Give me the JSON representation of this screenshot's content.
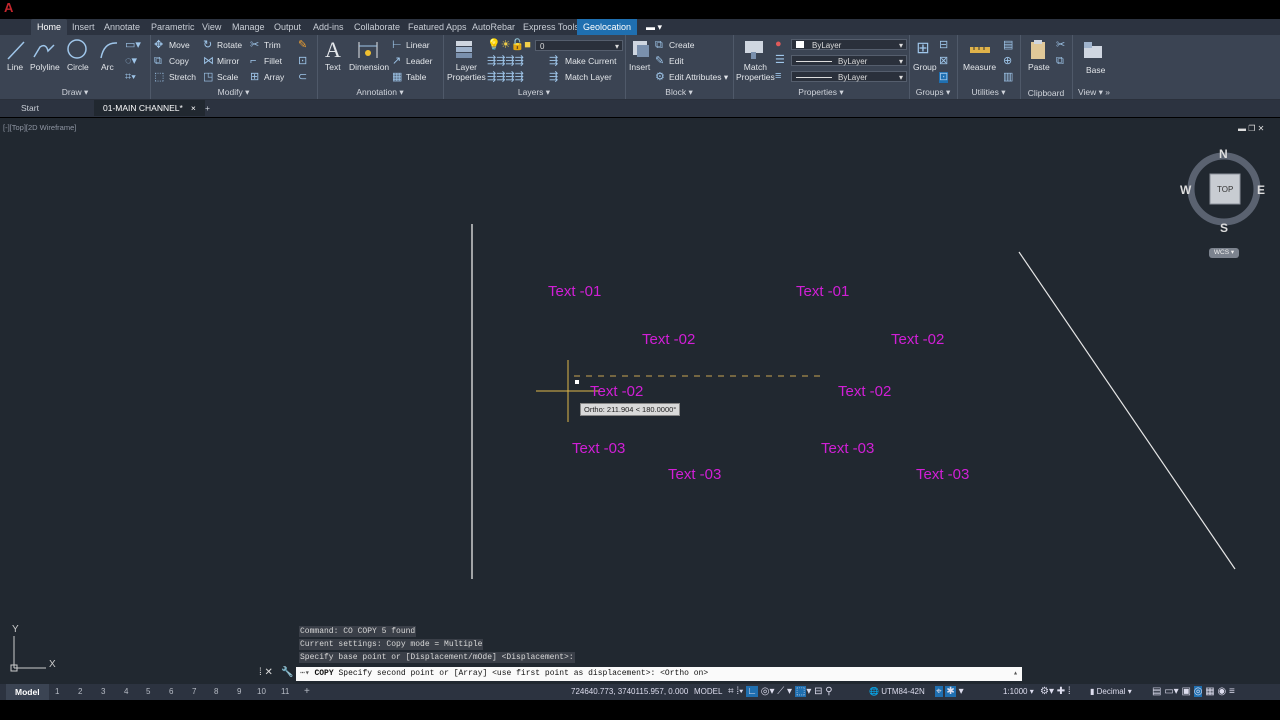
{
  "app": {
    "ribbon_tabs": [
      "Home",
      "Insert",
      "Annotate",
      "Parametric",
      "View",
      "Manage",
      "Output",
      "Add-ins",
      "Collaborate",
      "Featured Apps",
      "AutoRebar",
      "Express Tools",
      "Geolocation"
    ]
  },
  "ribbon": {
    "draw": {
      "title": "Draw",
      "tools": [
        "Line",
        "Polyline",
        "Circle",
        "Arc"
      ]
    },
    "modify": {
      "title": "Modify",
      "tools": [
        "Move",
        "Rotate",
        "Trim",
        "Copy",
        "Mirror",
        "Fillet",
        "Stretch",
        "Scale",
        "Array"
      ]
    },
    "annotation": {
      "title": "Annotation",
      "tools": [
        "Text",
        "Dimension",
        "Linear",
        "Leader",
        "Table"
      ]
    },
    "layers": {
      "title": "Layers",
      "tools": [
        "Layer Properties",
        "Make Current",
        "Match Layer"
      ],
      "current_layer": "0"
    },
    "block": {
      "title": "Block",
      "tools": [
        "Insert",
        "Create",
        "Edit",
        "Edit Attributes"
      ]
    },
    "properties": {
      "title": "Properties",
      "tools": [
        "Match Properties"
      ],
      "color": "ByLayer",
      "linetype": "ByLayer",
      "lineweight": "ByLayer"
    },
    "groups": {
      "title": "Groups",
      "tools": [
        "Group"
      ]
    },
    "utilities": {
      "title": "Utilities",
      "tools": [
        "Measure"
      ]
    },
    "clipboard": {
      "title": "Clipboard",
      "tools": [
        "Paste"
      ]
    },
    "view": {
      "title": "View",
      "tools": [
        "Base"
      ]
    }
  },
  "file_tabs": [
    "Start",
    "01-MAIN CHANNEL*"
  ],
  "viewport": {
    "label": "[-][Top][2D Wireframe]",
    "viewcube": {
      "n": "N",
      "s": "S",
      "e": "E",
      "w": "W",
      "face": "TOP",
      "ucs": "WCS"
    },
    "texts": [
      "Text -01",
      "Text -01",
      "Text -02",
      "Text -02",
      "Text -02",
      "Text -02",
      "Text -03",
      "Text -03",
      "Text -03",
      "Text -03"
    ],
    "tooltip": "Ortho: 211.904 < 180.0000°",
    "ucs_x": "X",
    "ucs_y": "Y"
  },
  "command": {
    "history": [
      "Command: CO COPY 5 found",
      "Current settings:  Copy mode = Multiple",
      "Specify base point or [Displacement/mOde] <Displacement>:"
    ],
    "prompt_cmd": "COPY",
    "prompt": "Specify second point or [Array] <use first point as displacement>:  <Ortho on>"
  },
  "status": {
    "layout_tabs": [
      "Model",
      "1",
      "2",
      "3",
      "4",
      "5",
      "6",
      "7",
      "8",
      "9",
      "10",
      "11"
    ],
    "coords": "724640.773, 3740115.957, 0.000",
    "space": "MODEL",
    "geo": "UTM84-42N",
    "scale": "1:1000",
    "units": "Decimal"
  },
  "colors": {
    "mtext": "#d11fd6",
    "canvas": "#212830",
    "ribbon": "#3b4453",
    "geo_tab": "#1f6fb0"
  }
}
